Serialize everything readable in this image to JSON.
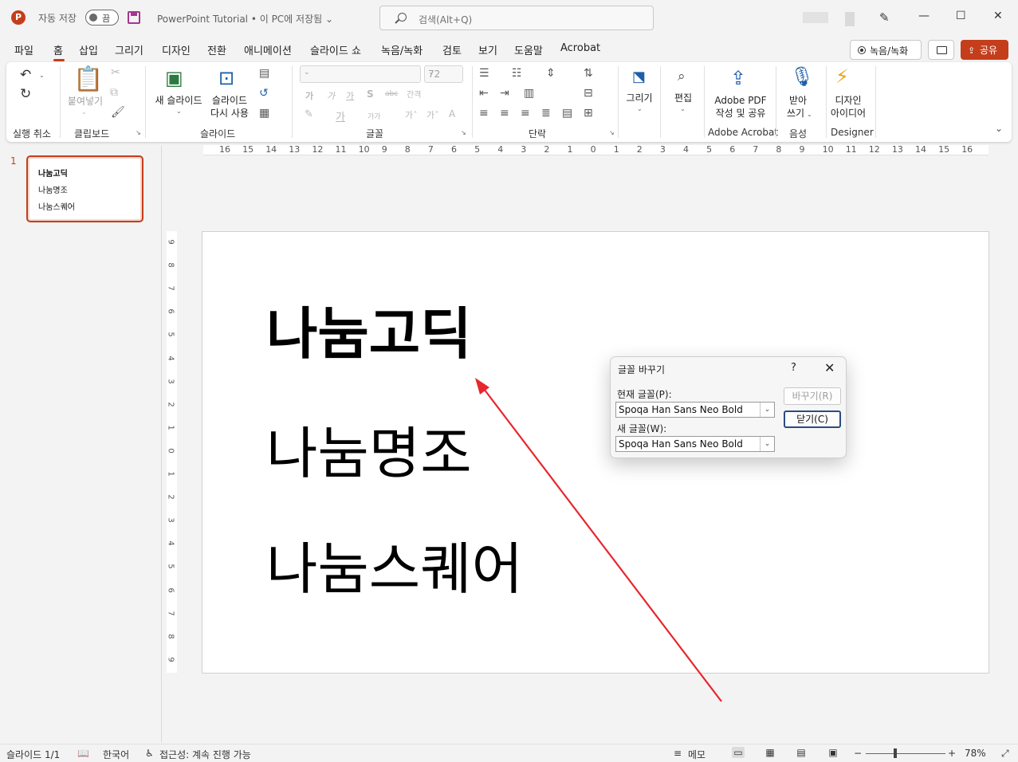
{
  "titlebar": {
    "app_letter": "P",
    "autosave_label": "자동 저장",
    "autosave_state": "끔",
    "doc_title": "PowerPoint Tutorial • 이 PC에 저장됨 ⌄",
    "search_placeholder": "검색(Alt+Q)",
    "minimize": "—",
    "maximize": "☐",
    "close": "✕"
  },
  "tabs": [
    "파일",
    "홈",
    "삽입",
    "그리기",
    "디자인",
    "전환",
    "애니메이션",
    "슬라이드 쇼",
    "녹음/녹화",
    "검토",
    "보기",
    "도움말",
    "Acrobat"
  ],
  "tab_active": "홈",
  "actions": {
    "record_label": "녹음/녹화",
    "share_label": "공유"
  },
  "ribbon": {
    "groups": {
      "undo": "실행 취소",
      "clipboard": "클립보드",
      "slides": "슬라이드",
      "font": "글꼴",
      "paragraph": "단락",
      "acrobat": "Adobe Acrobat",
      "voice": "음성",
      "designer": "Designer"
    },
    "paste_label": "붙여넣기",
    "new_slide_label": "새 슬라이드",
    "reuse_slide_label1": "슬라이드",
    "reuse_slide_label2": "다시 사용",
    "font_size": "72",
    "draw_label": "그리기",
    "edit_label": "편집",
    "pdf_label1": "Adobe PDF",
    "pdf_label2": "작성 및 공유",
    "dictate_label1": "받아",
    "dictate_label2": "쓰기",
    "designer_label1": "디자인",
    "designer_label2": "아이디어",
    "font_row1": [
      "가",
      "가",
      "가",
      "S",
      "abc",
      "간격"
    ],
    "font_row2": [
      "가",
      "가가",
      "가ˆ",
      "가ˇ",
      "A"
    ]
  },
  "rulers": {
    "h": [
      "16",
      "15",
      "14",
      "13",
      "12",
      "11",
      "10",
      "9",
      "8",
      "7",
      "6",
      "5",
      "4",
      "3",
      "2",
      "1",
      "0",
      "1",
      "2",
      "3",
      "4",
      "5",
      "6",
      "7",
      "8",
      "9",
      "10",
      "11",
      "12",
      "13",
      "14",
      "15",
      "16"
    ],
    "v": [
      "9",
      "8",
      "7",
      "6",
      "5",
      "4",
      "3",
      "2",
      "1",
      "0",
      "1",
      "2",
      "3",
      "4",
      "5",
      "6",
      "7",
      "8",
      "9"
    ]
  },
  "thumbnail": {
    "number": "1",
    "lines": [
      "나눔고딕",
      "나눔명조",
      "나눔스퀘어"
    ]
  },
  "slide": {
    "lines": [
      "나눔고딕",
      "나눔명조",
      "나눔스퀘어"
    ]
  },
  "dialog": {
    "title": "글꼴 바꾸기",
    "help": "?",
    "close": "✕",
    "current_label": "현재 글꼴(P):",
    "current_value": "Spoqa Han Sans Neo Bold",
    "new_label": "새 글꼴(W):",
    "new_value": "Spoqa Han Sans Neo Bold",
    "replace_btn": "바꾸기(R)",
    "close_btn": "닫기(C)"
  },
  "status": {
    "slide": "슬라이드 1/1",
    "language": "한국어",
    "accessibility": "접근성: 계속 진행 가능",
    "notes": "메모",
    "zoom_minus": "−",
    "zoom_plus": "+",
    "zoom": "78%"
  },
  "colors": {
    "accent": "#c43e1c",
    "arrow": "#e8262d"
  }
}
